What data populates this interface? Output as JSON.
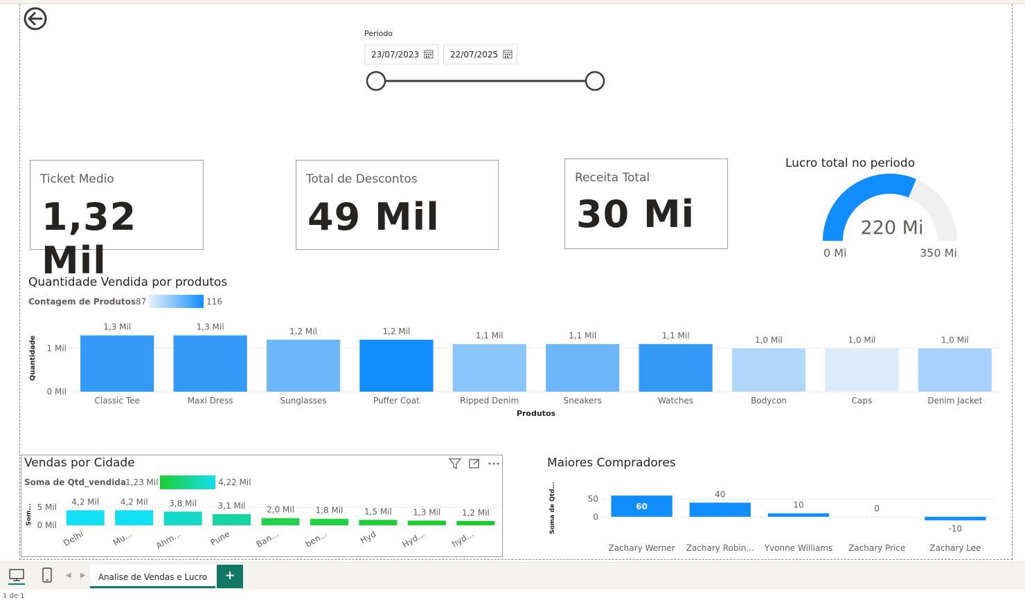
{
  "filter": {
    "label": "Periodo",
    "start_date": "23/07/2023",
    "end_date": "22/07/2025"
  },
  "cards": [
    {
      "title": "Ticket Medio",
      "value": "1,32 Mil"
    },
    {
      "title": "Total de Descontos",
      "value": "49 Mil"
    },
    {
      "title": "Receita Total",
      "value": "30 Mi"
    }
  ],
  "gauge": {
    "title": "Lucro total no periodo",
    "value_label": "220 Mi",
    "min_label": "0 Mi",
    "max_label": "350 Mi",
    "value": 220,
    "min": 0,
    "max": 350,
    "fill_color": "#118dff",
    "track_color": "#f0f0f0"
  },
  "products_chart": {
    "title": "Quantidade Vendida por produtos",
    "legend_label": "Contagem de Produtos",
    "legend_min": "87",
    "legend_max": "116"
  },
  "cities_chart": {
    "title": "Vendas por Cidade",
    "legend_label": "Soma de Qtd_vendida",
    "legend_min": "1,23 Mil",
    "legend_max": "4,22 Mil"
  },
  "buyers_chart": {
    "title": "Maiores Compradores"
  },
  "chart_data": [
    {
      "type": "bar",
      "title": "Quantidade Vendida por produtos",
      "xlabel": "Produtos",
      "ylabel": "Quantidade",
      "categories": [
        "Classic Tee",
        "Maxi Dress",
        "Sunglasses",
        "Puffer Coat",
        "Ripped Denim",
        "Sneakers",
        "Watches",
        "Bodycon",
        "Caps",
        "Denim Jacket"
      ],
      "values": [
        1.3,
        1.3,
        1.2,
        1.2,
        1.1,
        1.1,
        1.1,
        1.0,
        1.0,
        1.0
      ],
      "value_labels": [
        "1,3 Mil",
        "1,3 Mil",
        "1,2 Mil",
        "1,2 Mil",
        "1,1 Mil",
        "1,1 Mil",
        "1,1 Mil",
        "1,0 Mil",
        "1,0 Mil",
        "1,0 Mil"
      ],
      "colors": [
        "#3599f8",
        "#3599f8",
        "#6eb6fa",
        "#118dff",
        "#8cc5fb",
        "#6eb6fa",
        "#3599f8",
        "#b1d7fc",
        "#dcecfe",
        "#a8d2fc"
      ],
      "yticks": [
        0,
        1
      ],
      "ytick_labels": [
        "0 Mil",
        "1 Mil"
      ],
      "ylim": [
        0,
        1.55
      ]
    },
    {
      "type": "bar",
      "title": "Vendas por Cidade",
      "xlabel": "",
      "ylabel": "Som...",
      "categories": [
        "Delhi",
        "Mu...",
        "Ahm...",
        "Pune",
        "Ban...",
        "ben...",
        "Hyd",
        "Hyd...",
        "hyd..."
      ],
      "values": [
        4.2,
        4.2,
        3.8,
        3.1,
        2.0,
        1.8,
        1.5,
        1.3,
        1.2
      ],
      "value_labels": [
        "4,2 Mil",
        "4,2 Mil",
        "3,8 Mil",
        "3,1 Mil",
        "2,0 Mil",
        "1,8 Mil",
        "1,5 Mil",
        "1,3 Mil",
        "1,2 Mil"
      ],
      "colors": [
        "#12dff2",
        "#12dff2",
        "#14d9c6",
        "#15d4a0",
        "#22d24c",
        "#1ed23f",
        "#1dd03a",
        "#1ccf34",
        "#1bce30"
      ],
      "yticks": [
        0,
        5
      ],
      "ytick_labels": [
        "0 Mil",
        "5 Mil"
      ],
      "ylim": [
        0,
        6
      ]
    },
    {
      "type": "bar",
      "title": "Maiores Compradores",
      "xlabel": "",
      "ylabel": "Soma de Qtd...",
      "categories": [
        "Zachary Werner",
        "Zachary Robin...",
        "Yvonne Williams",
        "Zachary Price",
        "Zachary Lee"
      ],
      "values": [
        60,
        40,
        10,
        0,
        -10
      ],
      "value_labels": [
        "60",
        "40",
        "10",
        "0",
        "-10"
      ],
      "color": "#118dff",
      "yticks": [
        0,
        50
      ],
      "ytick_labels": [
        "0",
        "50"
      ],
      "ylim": [
        -20,
        70
      ]
    }
  ],
  "bottom_bar": {
    "page_tab": "Analise de Vendas e Lucro",
    "add_tab": "+",
    "status": "1 de 1"
  }
}
